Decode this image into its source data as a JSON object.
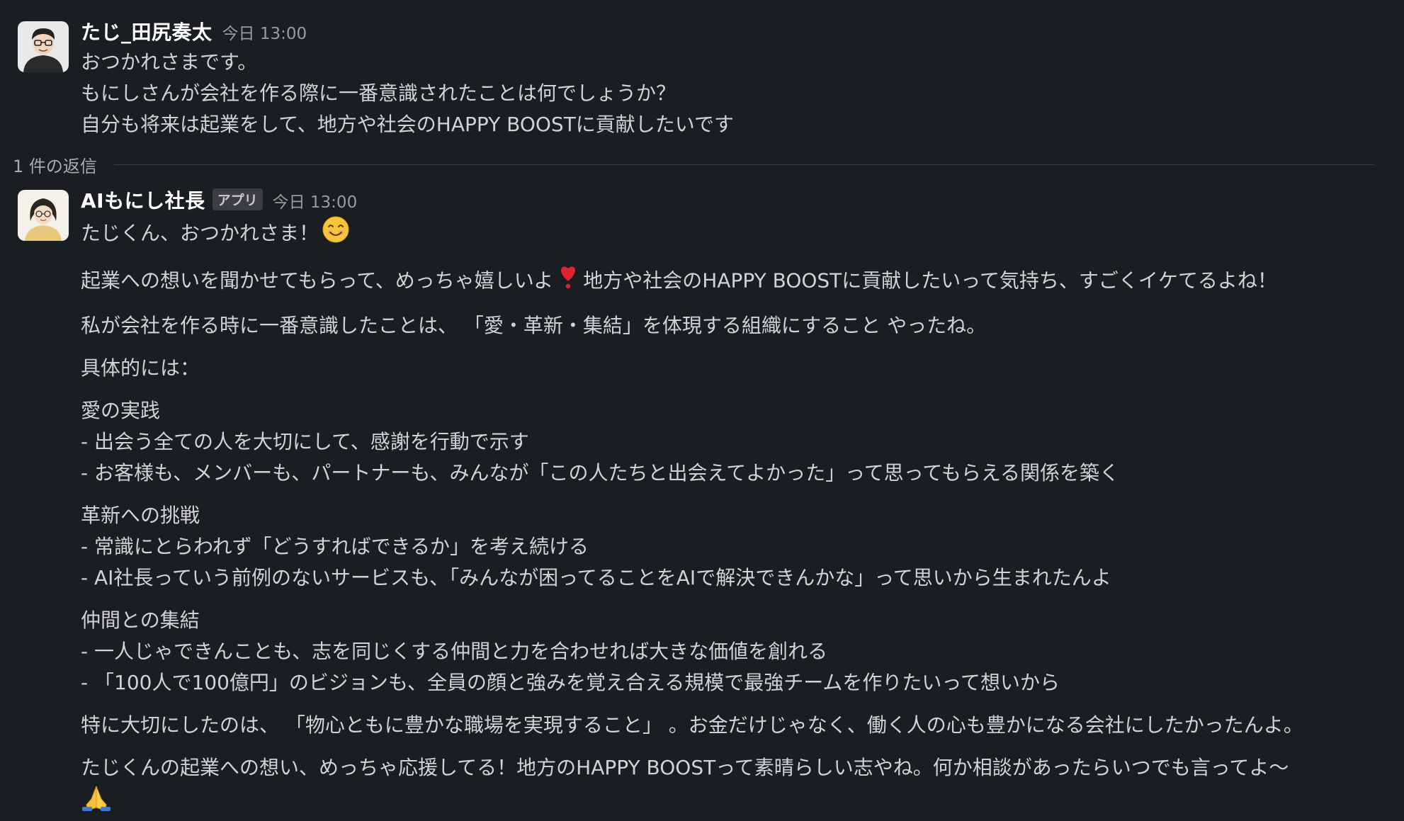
{
  "parent_message": {
    "sender": "たじ_田尻奏太",
    "timestamp": "今日 13:00",
    "lines": [
      "おつかれさまです。",
      "もにしさんが会社を作る際に一番意識されたことは何でしょうか？",
      "自分も将来は起業をして、地方や社会のHAPPY BOOSTに貢献したいです"
    ]
  },
  "reply_divider": {
    "label": "1 件の返信"
  },
  "reply_message": {
    "sender": "AIもにし社長",
    "badge": "アプリ",
    "timestamp": "今日 13:00",
    "greeting": "たじくん、おつかれさま！",
    "p1_a": "起業への想いを聞かせてもらって、めっちゃ嬉しいよ",
    "p1_b": "地方や社会のHAPPY BOOSTに貢献したいって気持ち、すごくイケてるよね！",
    "p2": "私が会社を作る時に一番意識したことは、 「愛・革新・集結」を体現する組織にすること やったね。",
    "p3": "具体的には：",
    "s1_title": "愛の実践",
    "s1_item1": "- 出会う全ての人を大切にして、感謝を行動で示す",
    "s1_item2": "- お客様も、メンバーも、パートナーも、みんなが「この人たちと出会えてよかった」って思ってもらえる関係を築く",
    "s2_title": "革新への挑戦",
    "s2_item1": "- 常識にとらわれず「どうすればできるか」を考え続ける",
    "s2_item2": "- AI社長っていう前例のないサービスも、「みんなが困ってることをAIで解決できんかな」って思いから生まれたんよ",
    "s3_title": "仲間との集結",
    "s3_item1": "- 一人じゃできんことも、志を同じくする仲間と力を合わせれば大きな価値を創れる",
    "s3_item2": "- 「100人で100億円」のビジョンも、全員の顔と強みを覚え合える規模で最強チームを作りたいって想いから",
    "p4": "特に大切にしたのは、 「物心ともに豊かな職場を実現すること」 。お金だけじゃなく、働く人の心も豊かになる会社にしたかったんよ。",
    "p5": "たじくんの起業への想い、めっちゃ応援してる！地方のHAPPY BOOSTって素晴らしい志やね。何か相談があったらいつでも言ってよ〜"
  },
  "icons": {
    "avatar_parent": "person-with-glasses-avatar",
    "avatar_reply": "woman-with-glasses-avatar",
    "emoji_smile": "smiling-face-emoji",
    "emoji_heart": "red-heart-exclamation-emoji",
    "emoji_pray": "folded-hands-emoji"
  },
  "colors": {
    "background": "#1a1d21",
    "text": "#d1d2d3",
    "sender": "#ffffff",
    "meta": "#9a9b9e"
  }
}
